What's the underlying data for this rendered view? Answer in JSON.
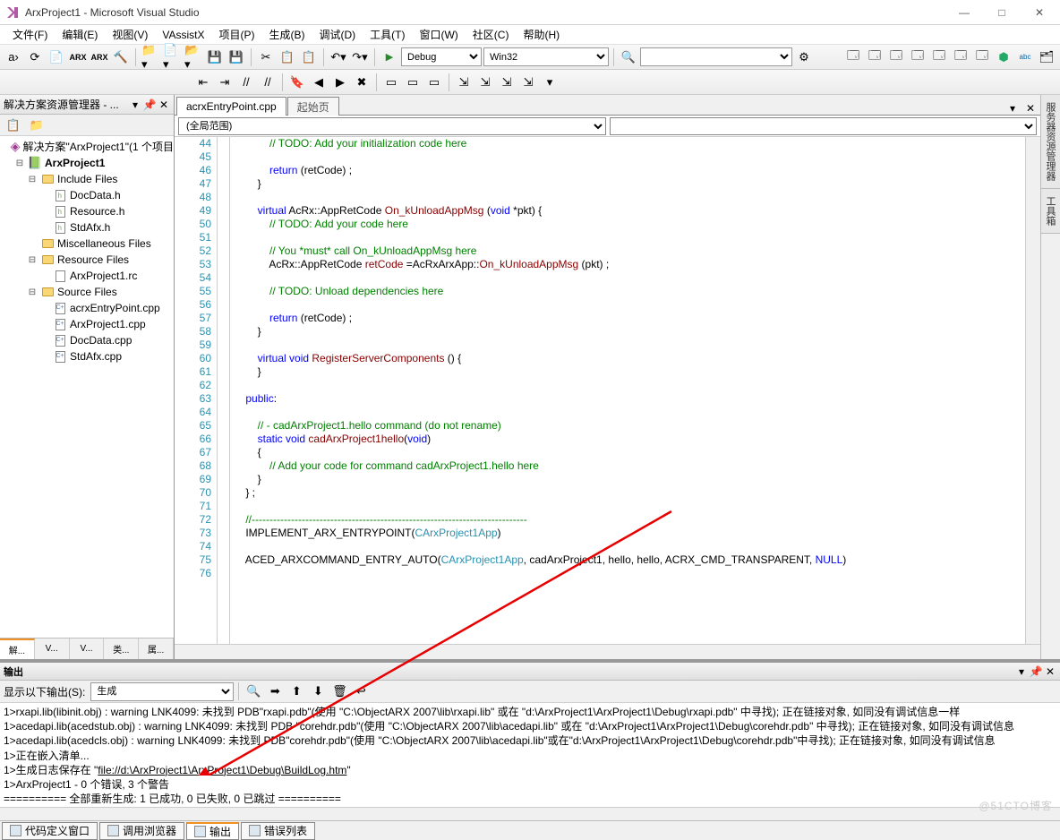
{
  "window": {
    "title": "ArxProject1 - Microsoft Visual Studio"
  },
  "menu": [
    "文件(F)",
    "编辑(E)",
    "视图(V)",
    "VAssistX",
    "项目(P)",
    "生成(B)",
    "调试(D)",
    "工具(T)",
    "窗口(W)",
    "社区(C)",
    "帮助(H)"
  ],
  "toolbar1": {
    "config": "Debug",
    "platform": "Win32"
  },
  "solutionExplorer": {
    "title": "解决方案资源管理器 - ... ",
    "root": "解决方案\"ArxProject1\"(1 个项目",
    "project": "ArxProject1",
    "includeFiles": "Include Files",
    "includeItems": [
      "DocData.h",
      "Resource.h",
      "StdAfx.h"
    ],
    "miscFiles": "Miscellaneous Files",
    "resourceFiles": "Resource Files",
    "resourceItems": [
      "ArxProject1.rc"
    ],
    "sourceFiles": "Source Files",
    "sourceItems": [
      "acrxEntryPoint.cpp",
      "ArxProject1.cpp",
      "DocData.cpp",
      "StdAfx.cpp"
    ],
    "sideTabs": [
      "解...",
      "V...",
      "V...",
      "类...",
      "属..."
    ]
  },
  "editor": {
    "tabs": [
      "acrxEntryPoint.cpp",
      "起始页"
    ],
    "scopeLeft": "(全局范围)",
    "lineStart": 44,
    "lines": [
      {
        "t": "            // TODO: Add your initialization code here",
        "cls": "c-comment"
      },
      {
        "t": ""
      },
      {
        "t": "            return (retCode) ;",
        "parts": [
          [
            "            ",
            ""
          ],
          [
            "return",
            "c-kw"
          ],
          [
            " (retCode) ;",
            ""
          ]
        ]
      },
      {
        "t": "        }"
      },
      {
        "t": ""
      },
      {
        "t": "        virtual AcRx::AppRetCode On_kUnloadAppMsg (void *pkt) {",
        "parts": [
          [
            "        ",
            ""
          ],
          [
            "virtual",
            "c-kw"
          ],
          [
            " AcRx::AppRetCode ",
            ""
          ],
          [
            "On_kUnloadAppMsg",
            "c-func"
          ],
          [
            " (",
            ""
          ],
          [
            "void",
            "c-kw"
          ],
          [
            " *pkt) {",
            ""
          ]
        ]
      },
      {
        "t": "            // TODO: Add your code here",
        "cls": "c-comment"
      },
      {
        "t": ""
      },
      {
        "t": "            // You *must* call On_kUnloadAppMsg here",
        "cls": "c-comment"
      },
      {
        "t": "            AcRx::AppRetCode retCode =AcRxArxApp::On_kUnloadAppMsg (pkt) ;",
        "parts": [
          [
            "            AcRx::AppRetCode ",
            ""
          ],
          [
            "retCode",
            "c-func"
          ],
          [
            " =AcRxArxApp::",
            ""
          ],
          [
            "On_kUnloadAppMsg",
            "c-func"
          ],
          [
            " (pkt) ;",
            ""
          ]
        ]
      },
      {
        "t": ""
      },
      {
        "t": "            // TODO: Unload dependencies here",
        "cls": "c-comment"
      },
      {
        "t": ""
      },
      {
        "t": "            return (retCode) ;",
        "parts": [
          [
            "            ",
            ""
          ],
          [
            "return",
            "c-kw"
          ],
          [
            " (retCode) ;",
            ""
          ]
        ]
      },
      {
        "t": "        }"
      },
      {
        "t": ""
      },
      {
        "t": "        virtual void RegisterServerComponents () {",
        "parts": [
          [
            "        ",
            ""
          ],
          [
            "virtual",
            "c-kw"
          ],
          [
            " ",
            ""
          ],
          [
            "void",
            "c-kw"
          ],
          [
            " ",
            ""
          ],
          [
            "RegisterServerComponents",
            "c-func"
          ],
          [
            " () {",
            ""
          ]
        ]
      },
      {
        "t": "        }"
      },
      {
        "t": ""
      },
      {
        "t": "    public:",
        "parts": [
          [
            "    ",
            ""
          ],
          [
            "public",
            "c-kw"
          ],
          [
            ":",
            ""
          ]
        ]
      },
      {
        "t": ""
      },
      {
        "t": "        // - cadArxProject1.hello command (do not rename)",
        "cls": "c-comment"
      },
      {
        "t": "        static void cadArxProject1hello(void)",
        "parts": [
          [
            "        ",
            ""
          ],
          [
            "static",
            "c-kw"
          ],
          [
            " ",
            ""
          ],
          [
            "void",
            "c-kw"
          ],
          [
            " ",
            ""
          ],
          [
            "cadArxProject1hello",
            "c-func"
          ],
          [
            "(",
            ""
          ],
          [
            "void",
            "c-kw"
          ],
          [
            ")",
            ""
          ]
        ]
      },
      {
        "t": "        {"
      },
      {
        "t": "            // Add your code for command cadArxProject1.hello here",
        "cls": "c-comment"
      },
      {
        "t": "        }"
      },
      {
        "t": "    } ;"
      },
      {
        "t": ""
      },
      {
        "t": "    //-----------------------------------------------------------------------------",
        "cls": "c-comment"
      },
      {
        "t": "    IMPLEMENT_ARX_ENTRYPOINT(CArxProject1App)",
        "parts": [
          [
            "    ",
            ""
          ],
          [
            "IMPLEMENT_ARX_ENTRYPOINT",
            ""
          ],
          [
            "(",
            ""
          ],
          [
            "CArxProject1App",
            "c-type"
          ],
          [
            ")",
            ""
          ]
        ]
      },
      {
        "t": ""
      },
      {
        "t": "    ACED_ARXCOMMAND_ENTRY_AUTO(CArxProject1App, cadArxProject1, hello, hello, ACRX_CMD_TRANSPARENT, NULL)",
        "parts": [
          [
            "    ",
            ""
          ],
          [
            "ACED_ARXCOMMAND_ENTRY_AUTO",
            ""
          ],
          [
            "(",
            ""
          ],
          [
            "CArxProject1App",
            "c-type"
          ],
          [
            ", ca",
            ""
          ],
          [
            "d",
            ""
          ],
          [
            "ArxProject1, hello, hello, ACRX_CMD_TRANSPARENT, ",
            ""
          ],
          [
            "NULL",
            "c-kw"
          ],
          [
            ")",
            ""
          ]
        ]
      },
      {
        "t": ""
      }
    ]
  },
  "output": {
    "title": "输出",
    "sourceLabel": "显示以下输出(S):",
    "source": "生成",
    "lines": [
      "1>rxapi.lib(libinit.obj) : warning LNK4099: 未找到 PDB\"rxapi.pdb\"(使用 \"C:\\ObjectARX 2007\\lib\\rxapi.lib\" 或在 \"d:\\ArxProject1\\ArxProject1\\Debug\\rxapi.pdb\" 中寻找); 正在链接对象, 如同没有调试信息一样",
      "1>acedapi.lib(acedstub.obj) : warning LNK4099: 未找到 PDB \"corehdr.pdb\"(使用 \"C:\\ObjectARX 2007\\lib\\acedapi.lib\" 或在 \"d:\\ArxProject1\\ArxProject1\\Debug\\corehdr.pdb\" 中寻找); 正在链接对象, 如同没有调试信息",
      "1>acedapi.lib(acedcls.obj) : warning LNK4099: 未找到 PDB\"corehdr.pdb\"(使用 \"C:\\ObjectARX 2007\\lib\\acedapi.lib\"或在\"d:\\ArxProject1\\ArxProject1\\Debug\\corehdr.pdb\"中寻找); 正在链接对象, 如同没有调试信息",
      "1>正在嵌入清单...",
      "1>生成日志保存在 \"file://d:\\ArxProject1\\ArxProject1\\Debug\\BuildLog.htm\"",
      "1>ArxProject1 - 0 个错误, 3 个警告",
      "========== 全部重新生成: 1 已成功, 0 已失败, 0 已跳过 =========="
    ],
    "logLink": "file://d:\\ArxProject1\\ArxProject1\\Debug\\BuildLog.htm"
  },
  "bottomTabs": [
    "代码定义窗口",
    "调用浏览器",
    "输出",
    "错误列表"
  ],
  "rightTabs": [
    "服务器资源管理器",
    "工具箱"
  ],
  "watermark": "@51CTO博客"
}
